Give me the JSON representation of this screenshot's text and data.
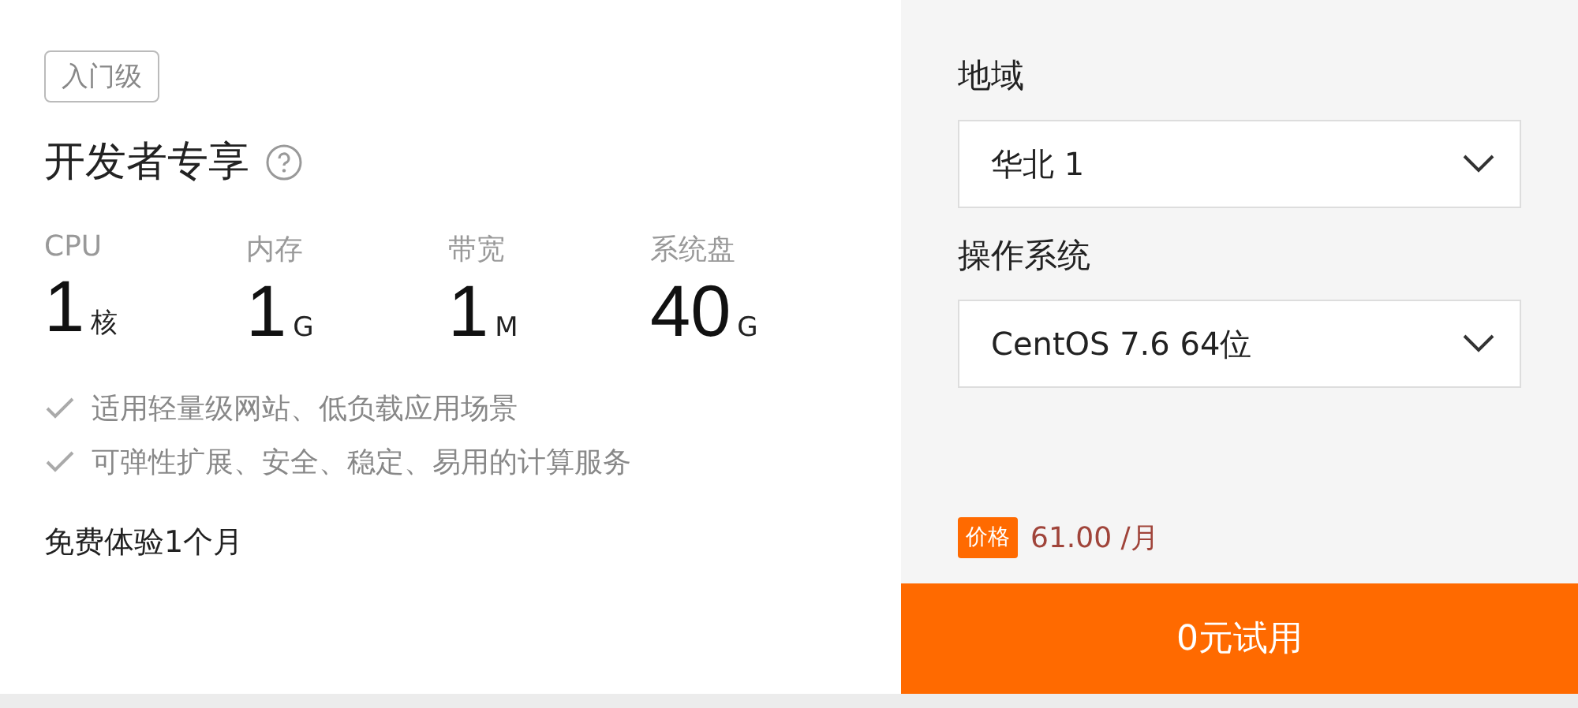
{
  "plan": {
    "badge": "入门级",
    "title": "开发者专享",
    "specs": [
      {
        "label": "CPU",
        "value": "1",
        "unit": "核"
      },
      {
        "label": "内存",
        "value": "1",
        "unit": "G"
      },
      {
        "label": "带宽",
        "value": "1",
        "unit": "M"
      },
      {
        "label": "系统盘",
        "value": "40",
        "unit": "G"
      }
    ],
    "features": [
      "适用轻量级网站、低负载应用场景",
      "可弹性扩展、安全、稳定、易用的计算服务"
    ],
    "trial": "免费体验1个月"
  },
  "order": {
    "fields": [
      {
        "label": "地域",
        "value": "华北 1"
      },
      {
        "label": "操作系统",
        "value": "CentOS 7.6 64位"
      }
    ],
    "price_tag": "价格",
    "price": "61.00 /月",
    "button": "0元试用"
  }
}
